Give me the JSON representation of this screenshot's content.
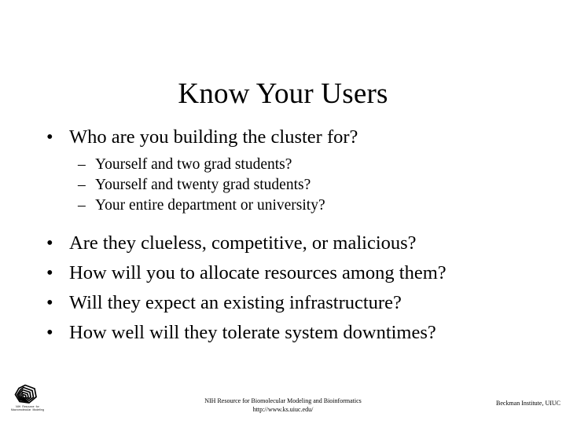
{
  "slide": {
    "title": "Know Your Users",
    "bullets_group1": [
      {
        "level": 1,
        "marker": "•",
        "text": "Who are you building the cluster for?"
      }
    ],
    "sub_bullets": [
      {
        "level": 2,
        "marker": "–",
        "text": "Yourself and two grad students?"
      },
      {
        "level": 2,
        "marker": "–",
        "text": "Yourself and twenty grad students?"
      },
      {
        "level": 2,
        "marker": "–",
        "text": "Your entire department or university?"
      }
    ],
    "bullets_group2": [
      {
        "level": 1,
        "marker": "•",
        "text": "Are they clueless, competitive, or malicious?"
      },
      {
        "level": 1,
        "marker": "•",
        "text": "How will you to allocate resources among them?"
      },
      {
        "level": 1,
        "marker": "•",
        "text": "Will they expect an existing infrastructure?"
      },
      {
        "level": 1,
        "marker": "•",
        "text": "How well will they tolerate system downtimes?"
      }
    ]
  },
  "footer": {
    "center_line1": "NIH Resource for Biomolecular Modeling and Bioinformatics",
    "center_line2": "http://www.ks.uiuc.edu/",
    "right": "Beckman Institute, UIUC"
  },
  "logo": {
    "caption_line1": "NIH Resource for",
    "caption_line2": "Macromolecular Modeling"
  },
  "colors": {
    "background": "#ffffff",
    "text": "#000000"
  }
}
